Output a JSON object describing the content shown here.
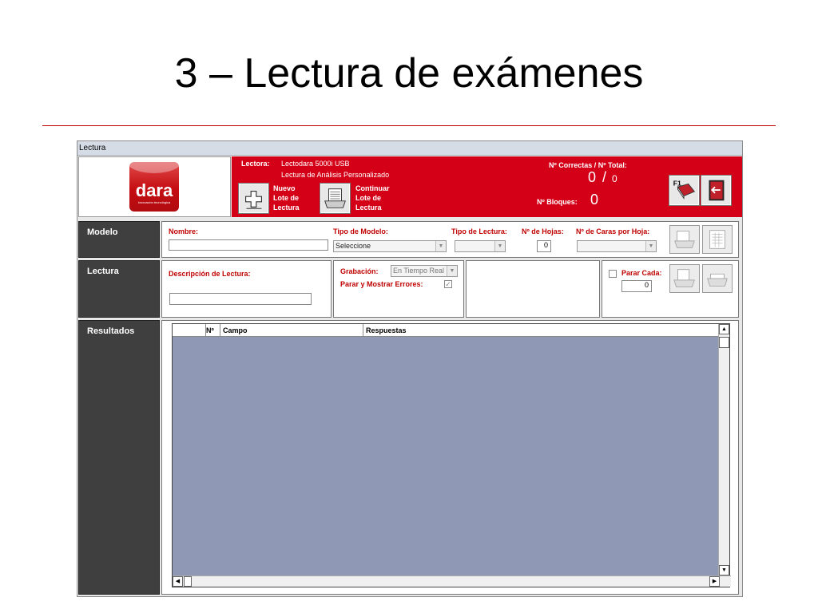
{
  "slide": {
    "title": "3 – Lectura de exámenes"
  },
  "window": {
    "title": "Lectura"
  },
  "logo": {
    "text": "dara",
    "subtitle": "innovación tecnológica"
  },
  "header": {
    "lectora_label": "Lectora:",
    "lectora_value": "Lectodara 5000i USB",
    "lectura_type": "Lectura de Análisis Personalizado",
    "nuevo_lote": [
      "Nuevo",
      "Lote de",
      "Lectura"
    ],
    "continuar_lote": [
      "Continuar",
      "Lote de",
      "Lectura"
    ],
    "correctas_label": "Nº Correctas / Nº Total:",
    "correctas_value": "0",
    "slash": "/",
    "total_value": "0",
    "bloques_label": "Nº Bloques:",
    "bloques_value": "0",
    "help_key": "F1"
  },
  "sections": {
    "modelo": "Modelo",
    "lectura": "Lectura",
    "resultados": "Resultados"
  },
  "modelo": {
    "nombre_label": "Nombre:",
    "nombre_value": "",
    "tipo_modelo_label": "Tipo de Modelo:",
    "tipo_modelo_value": "Seleccione",
    "tipo_lectura_label": "Tipo de Lectura:",
    "tipo_lectura_value": "",
    "hojas_label": "Nº de Hojas:",
    "hojas_value": "0",
    "caras_label": "Nº de Caras por Hoja:",
    "caras_value": ""
  },
  "lectura": {
    "descripcion_label": "Descripción de Lectura:",
    "descripcion_value": "",
    "grabacion_label": "Grabación:",
    "grabacion_value": "En Tiempo Real",
    "parar_errores_label": "Parar y Mostrar Errores:",
    "parar_errores_checked": true,
    "parar_cada_label": "Parar Cada:",
    "parar_cada_checked": false,
    "parar_cada_value": "0"
  },
  "grid": {
    "columns": [
      "Nº",
      "Campo",
      "Respuestas"
    ]
  },
  "colors": {
    "brand_red": "#d40018",
    "grid_bg": "#8f99b5",
    "label_red": "#c00000"
  }
}
